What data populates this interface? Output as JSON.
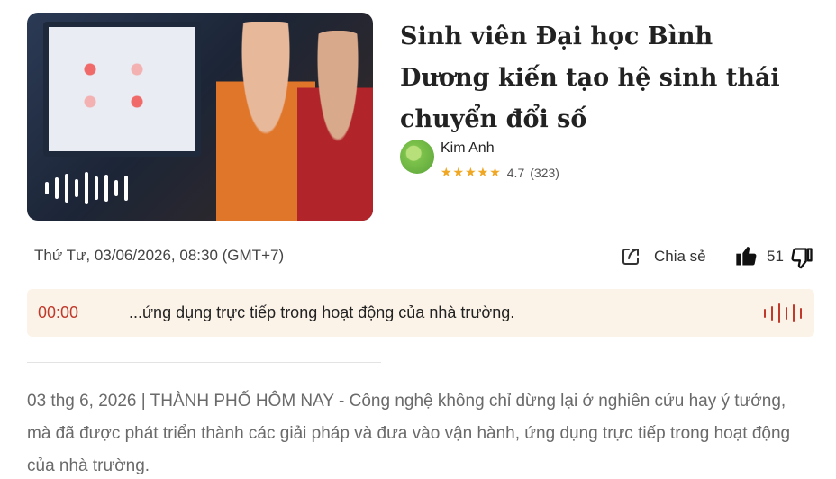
{
  "article": {
    "title": "Sinh viên Đại học Bình Dương kiến tạo hệ sinh thái chuyển đổi số",
    "author": "Kim Anh",
    "rating_stars": "★★★★★",
    "rating_value": "4.7",
    "rating_count": "(323)",
    "datetime": "Thứ Tư, 03/06/2026, 08:30 (GMT+7)",
    "share_label": "Chia sẻ",
    "like_count": "51",
    "body": "03 thg 6, 2026 | THÀNH PHỐ HÔM NAY - Công nghệ không chỉ dừng lại ở nghiên cứu hay ý tưởng, mà đã được phát triển thành các giải pháp và đưa vào vận hành, ứng dụng trực tiếp trong hoạt động của nhà trường."
  },
  "audio_player": {
    "time": "00:00",
    "caption": "...ứng dụng trực tiếp trong hoạt động của nhà trường."
  },
  "icons": {
    "share": "share-icon",
    "like": "thumbs-up-icon",
    "dislike": "thumbs-down-icon",
    "audio_wave": "audio-wave-icon"
  },
  "colors": {
    "accent": "#c0392b",
    "player_bg": "#fcf3e8",
    "star": "#f0a724"
  }
}
